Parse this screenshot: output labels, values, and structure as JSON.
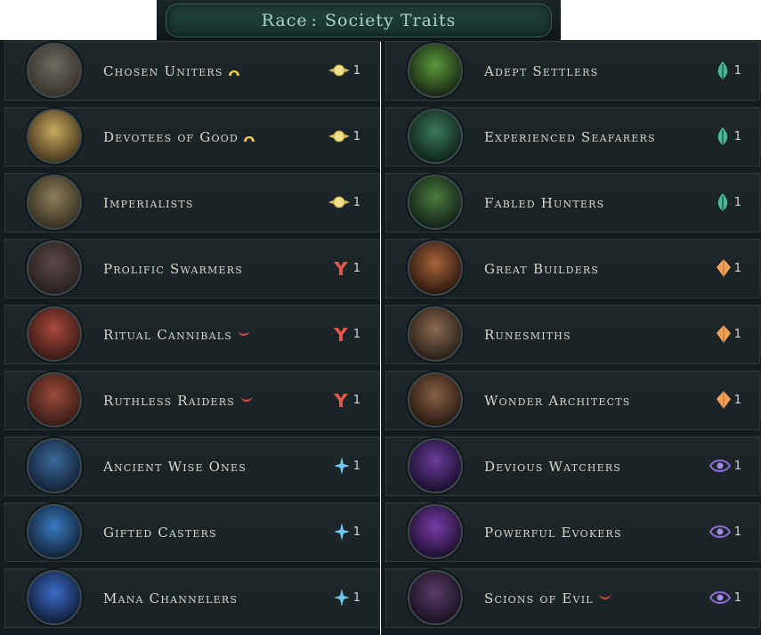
{
  "header": {
    "label": "Race",
    "separator": ":",
    "title": "Society Traits"
  },
  "left_traits": [
    {
      "name": "Chosen Uniters",
      "tag": "crescent-icon",
      "cost": "1",
      "cost_icon": "gold-coin-icon",
      "portrait": "lantern-portrait",
      "colors": [
        "#6f6a5e",
        "#3a352c"
      ]
    },
    {
      "name": "Devotees of Good",
      "tag": "crescent-icon",
      "cost": "1",
      "cost_icon": "gold-coin-icon",
      "portrait": "haloed-figure-portrait",
      "colors": [
        "#c9a860",
        "#4a3a1f"
      ]
    },
    {
      "name": "Imperialists",
      "tag": "",
      "cost": "1",
      "cost_icon": "gold-coin-icon",
      "portrait": "key-portrait",
      "colors": [
        "#8c7c5a",
        "#3a3322"
      ]
    },
    {
      "name": "Prolific Swarmers",
      "tag": "",
      "cost": "1",
      "cost_icon": "red-fork-icon",
      "portrait": "rats-portrait",
      "colors": [
        "#5a4a48",
        "#2a2020"
      ]
    },
    {
      "name": "Ritual Cannibals",
      "tag": "horns-icon",
      "cost": "1",
      "cost_icon": "red-fork-icon",
      "portrait": "meat-portrait",
      "colors": [
        "#a84a3c",
        "#3c1a16"
      ]
    },
    {
      "name": "Ruthless Raiders",
      "tag": "horns-icon",
      "cost": "1",
      "cost_icon": "red-fork-icon",
      "portrait": "skull-portrait",
      "colors": [
        "#9a4a3a",
        "#3a1c16"
      ]
    },
    {
      "name": "Ancient Wise Ones",
      "tag": "",
      "cost": "1",
      "cost_icon": "blue-star-icon",
      "portrait": "hooded-sage-portrait",
      "colors": [
        "#3a6a9a",
        "#14233a"
      ]
    },
    {
      "name": "Gifted Casters",
      "tag": "",
      "cost": "1",
      "cost_icon": "blue-star-icon",
      "portrait": "magic-hand-portrait",
      "colors": [
        "#3a7cc0",
        "#12243c"
      ]
    },
    {
      "name": "Mana Channelers",
      "tag": "",
      "cost": "1",
      "cost_icon": "blue-star-icon",
      "portrait": "crystal-portrait",
      "colors": [
        "#3c6cc8",
        "#111f3c"
      ]
    }
  ],
  "right_traits": [
    {
      "name": "Adept Settlers",
      "tag": "",
      "cost": "1",
      "cost_icon": "teal-leaf-icon",
      "portrait": "sprout-portrait",
      "colors": [
        "#5a9a3c",
        "#1a2a14"
      ]
    },
    {
      "name": "Experienced Seafarers",
      "tag": "",
      "cost": "1",
      "cost_icon": "teal-leaf-icon",
      "portrait": "sextant-portrait",
      "colors": [
        "#3a7a5a",
        "#10241c"
      ]
    },
    {
      "name": "Fabled Hunters",
      "tag": "",
      "cost": "1",
      "cost_icon": "teal-leaf-icon",
      "portrait": "bow-portrait",
      "colors": [
        "#4a7a3c",
        "#14241a"
      ]
    },
    {
      "name": "Great Builders",
      "tag": "",
      "cost": "1",
      "cost_icon": "amber-gem-icon",
      "portrait": "hammer-portrait",
      "colors": [
        "#a8643a",
        "#2e1a10"
      ]
    },
    {
      "name": "Runesmiths",
      "tag": "",
      "cost": "1",
      "cost_icon": "amber-gem-icon",
      "portrait": "rune-stones-portrait",
      "colors": [
        "#8a6a52",
        "#2c2018"
      ]
    },
    {
      "name": "Wonder Architects",
      "tag": "",
      "cost": "1",
      "cost_icon": "amber-gem-icon",
      "portrait": "cart-portrait",
      "colors": [
        "#8a6044",
        "#2a1c12"
      ]
    },
    {
      "name": "Devious Watchers",
      "tag": "",
      "cost": "1",
      "cost_icon": "purple-eye-icon",
      "portrait": "raven-portrait",
      "colors": [
        "#6a3c9a",
        "#1c1030"
      ]
    },
    {
      "name": "Powerful Evokers",
      "tag": "",
      "cost": "1",
      "cost_icon": "purple-eye-icon",
      "portrait": "claw-portrait",
      "colors": [
        "#7a3ca8",
        "#1e1032"
      ]
    },
    {
      "name": "Scions of Evil",
      "tag": "horns-icon",
      "cost": "1",
      "cost_icon": "purple-eye-icon",
      "portrait": "hooded-evil-portrait",
      "colors": [
        "#5a3c6a",
        "#1a1220"
      ]
    }
  ]
}
